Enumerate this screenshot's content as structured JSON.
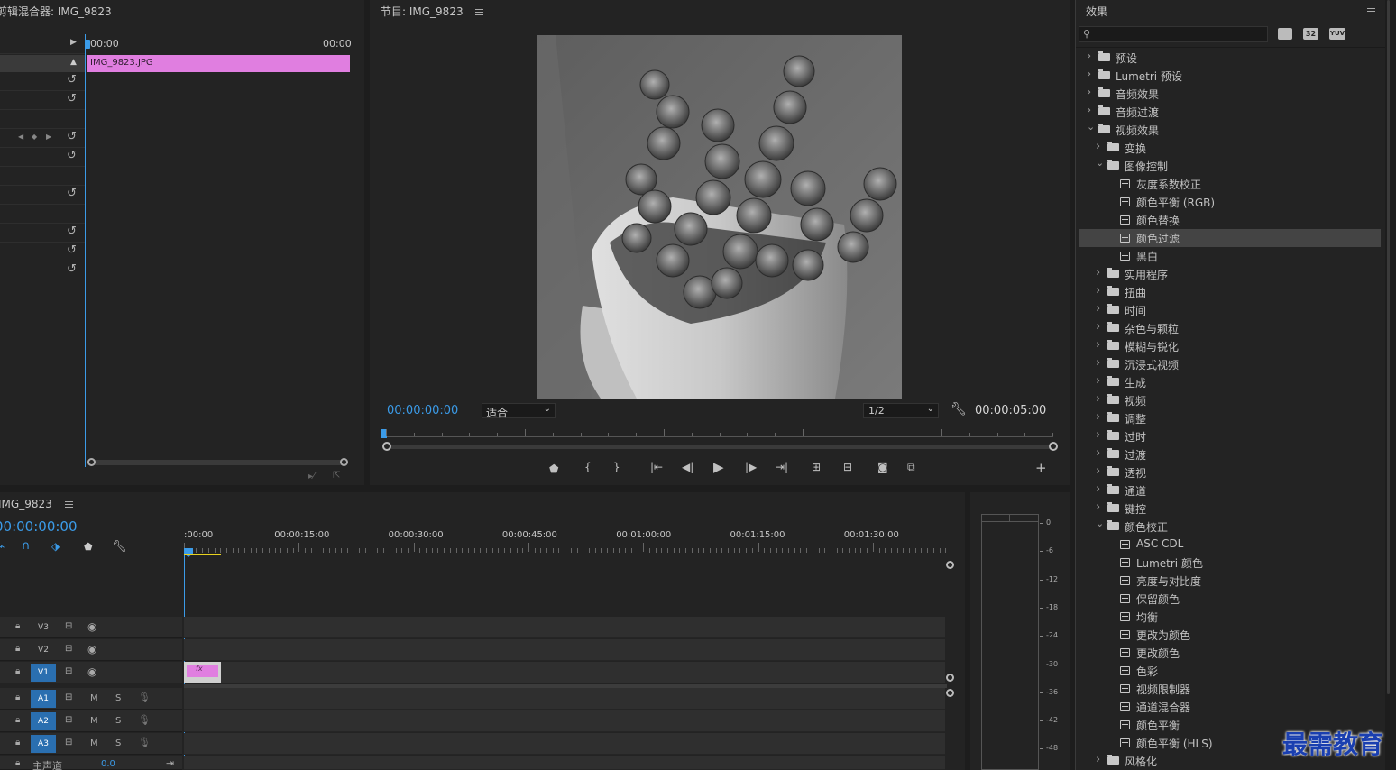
{
  "effect_controls": {
    "title": "剪辑混合器: IMG_9823",
    "time_start": "00:00",
    "time_end": "00:00",
    "clip_label": "IMG_9823.JPG"
  },
  "program_monitor": {
    "title": "节目: IMG_9823",
    "timecode": "00:00:00:00",
    "fit_option": "适合",
    "resolution": "1/2",
    "duration": "00:00:05:00"
  },
  "effects": {
    "title": "效果",
    "search_placeholder": "",
    "badge_32": "32",
    "badge_yuv": "YUV",
    "tree": [
      {
        "label": "预设",
        "level": 0,
        "kind": "preset",
        "expanded": false
      },
      {
        "label": "Lumetri 预设",
        "level": 0,
        "kind": "preset",
        "expanded": false
      },
      {
        "label": "音频效果",
        "level": 0,
        "kind": "folder",
        "expanded": false
      },
      {
        "label": "音频过渡",
        "level": 0,
        "kind": "folder",
        "expanded": false
      },
      {
        "label": "视频效果",
        "level": 0,
        "kind": "folder",
        "expanded": true
      },
      {
        "label": "变换",
        "level": 1,
        "kind": "folder",
        "expanded": false
      },
      {
        "label": "图像控制",
        "level": 1,
        "kind": "folder",
        "expanded": true
      },
      {
        "label": "灰度系数校正",
        "level": 2,
        "kind": "effect"
      },
      {
        "label": "颜色平衡 (RGB)",
        "level": 2,
        "kind": "effect"
      },
      {
        "label": "颜色替换",
        "level": 2,
        "kind": "effect"
      },
      {
        "label": "颜色过滤",
        "level": 2,
        "kind": "effect",
        "selected": true
      },
      {
        "label": "黑白",
        "level": 2,
        "kind": "effect"
      },
      {
        "label": "实用程序",
        "level": 1,
        "kind": "folder",
        "expanded": false
      },
      {
        "label": "扭曲",
        "level": 1,
        "kind": "folder",
        "expanded": false
      },
      {
        "label": "时间",
        "level": 1,
        "kind": "folder",
        "expanded": false
      },
      {
        "label": "杂色与颗粒",
        "level": 1,
        "kind": "folder",
        "expanded": false
      },
      {
        "label": "模糊与锐化",
        "level": 1,
        "kind": "folder",
        "expanded": false
      },
      {
        "label": "沉浸式视频",
        "level": 1,
        "kind": "folder",
        "expanded": false
      },
      {
        "label": "生成",
        "level": 1,
        "kind": "folder",
        "expanded": false
      },
      {
        "label": "视频",
        "level": 1,
        "kind": "folder",
        "expanded": false
      },
      {
        "label": "调整",
        "level": 1,
        "kind": "folder",
        "expanded": false
      },
      {
        "label": "过时",
        "level": 1,
        "kind": "folder",
        "expanded": false
      },
      {
        "label": "过渡",
        "level": 1,
        "kind": "folder",
        "expanded": false
      },
      {
        "label": "透视",
        "level": 1,
        "kind": "folder",
        "expanded": false
      },
      {
        "label": "通道",
        "level": 1,
        "kind": "folder",
        "expanded": false
      },
      {
        "label": "键控",
        "level": 1,
        "kind": "folder",
        "expanded": false
      },
      {
        "label": "颜色校正",
        "level": 1,
        "kind": "folder",
        "expanded": true
      },
      {
        "label": "ASC CDL",
        "level": 2,
        "kind": "effect"
      },
      {
        "label": "Lumetri 颜色",
        "level": 2,
        "kind": "effect"
      },
      {
        "label": "亮度与对比度",
        "level": 2,
        "kind": "effect"
      },
      {
        "label": "保留颜色",
        "level": 2,
        "kind": "effect"
      },
      {
        "label": "均衡",
        "level": 2,
        "kind": "effect"
      },
      {
        "label": "更改为颜色",
        "level": 2,
        "kind": "effect"
      },
      {
        "label": "更改颜色",
        "level": 2,
        "kind": "effect"
      },
      {
        "label": "色彩",
        "level": 2,
        "kind": "effect"
      },
      {
        "label": "视频限制器",
        "level": 2,
        "kind": "effect"
      },
      {
        "label": "通道混合器",
        "level": 2,
        "kind": "effect"
      },
      {
        "label": "颜色平衡",
        "level": 2,
        "kind": "effect"
      },
      {
        "label": "颜色平衡 (HLS)",
        "level": 2,
        "kind": "effect"
      },
      {
        "label": "风格化",
        "level": 1,
        "kind": "folder",
        "expanded": false
      }
    ]
  },
  "timeline": {
    "title": "IMG_9823",
    "timecode": "00:00:00:00",
    "ruler": [
      ":00:00",
      "00:00:15:00",
      "00:00:30:00",
      "00:00:45:00",
      "00:01:00:00",
      "00:01:15:00",
      "00:01:30:00"
    ],
    "video_tracks": [
      "V3",
      "V2",
      "V1"
    ],
    "audio_tracks": [
      "A1",
      "A2",
      "A3"
    ],
    "mute_label": "M",
    "solo_label": "S",
    "master_label": "主声道",
    "master_value": "0.0",
    "clip_fx": "fx"
  },
  "audio_meter": {
    "scale": [
      "0",
      "-6",
      "-12",
      "-18",
      "-24",
      "-30",
      "-36",
      "-42",
      "-48"
    ]
  },
  "watermark": "最需教育",
  "colors": {
    "accent_blue": "#3b9be8",
    "clip_pink": "#e07ee0",
    "track_target_blue": "#2a6fb0",
    "work_area_yellow": "#e8d21e"
  }
}
